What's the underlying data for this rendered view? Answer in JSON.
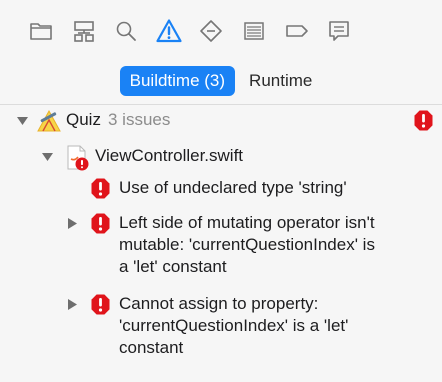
{
  "toolbar": {
    "icons": [
      {
        "name": "project-navigator-folder-icon",
        "active": false
      },
      {
        "name": "symbol-navigator-hierarchy-icon",
        "active": false
      },
      {
        "name": "find-navigator-magnifier-icon",
        "active": false
      },
      {
        "name": "issue-navigator-warning-icon",
        "active": true
      },
      {
        "name": "test-navigator-diamond-icon",
        "active": false
      },
      {
        "name": "debug-navigator-gauge-icon",
        "active": false
      },
      {
        "name": "breakpoint-navigator-tag-icon",
        "active": false
      },
      {
        "name": "report-navigator-bubble-icon",
        "active": false
      }
    ],
    "active_color": "#1a82f5",
    "icon_color": "#767676"
  },
  "segments": {
    "buildtime": "Buildtime (3)",
    "runtime": "Runtime",
    "selected": "buildtime"
  },
  "project": {
    "name": "Quiz",
    "count": "3 issues",
    "icon": "xcode-hammer-icon"
  },
  "file": {
    "name": "ViewController.swift",
    "icon": "swift-file-icon"
  },
  "issues": [
    {
      "lines": [
        "Use of undeclared type 'string'"
      ],
      "expandable": false
    },
    {
      "lines": [
        "Left side of mutating operator isn't",
        "mutable: 'currentQuestionIndex' is",
        "a 'let' constant"
      ],
      "expandable": true
    },
    {
      "lines": [
        "Cannot assign to property:",
        "'currentQuestionIndex' is a 'let'",
        "constant"
      ],
      "expandable": true
    }
  ],
  "error_color": "#e0141b"
}
